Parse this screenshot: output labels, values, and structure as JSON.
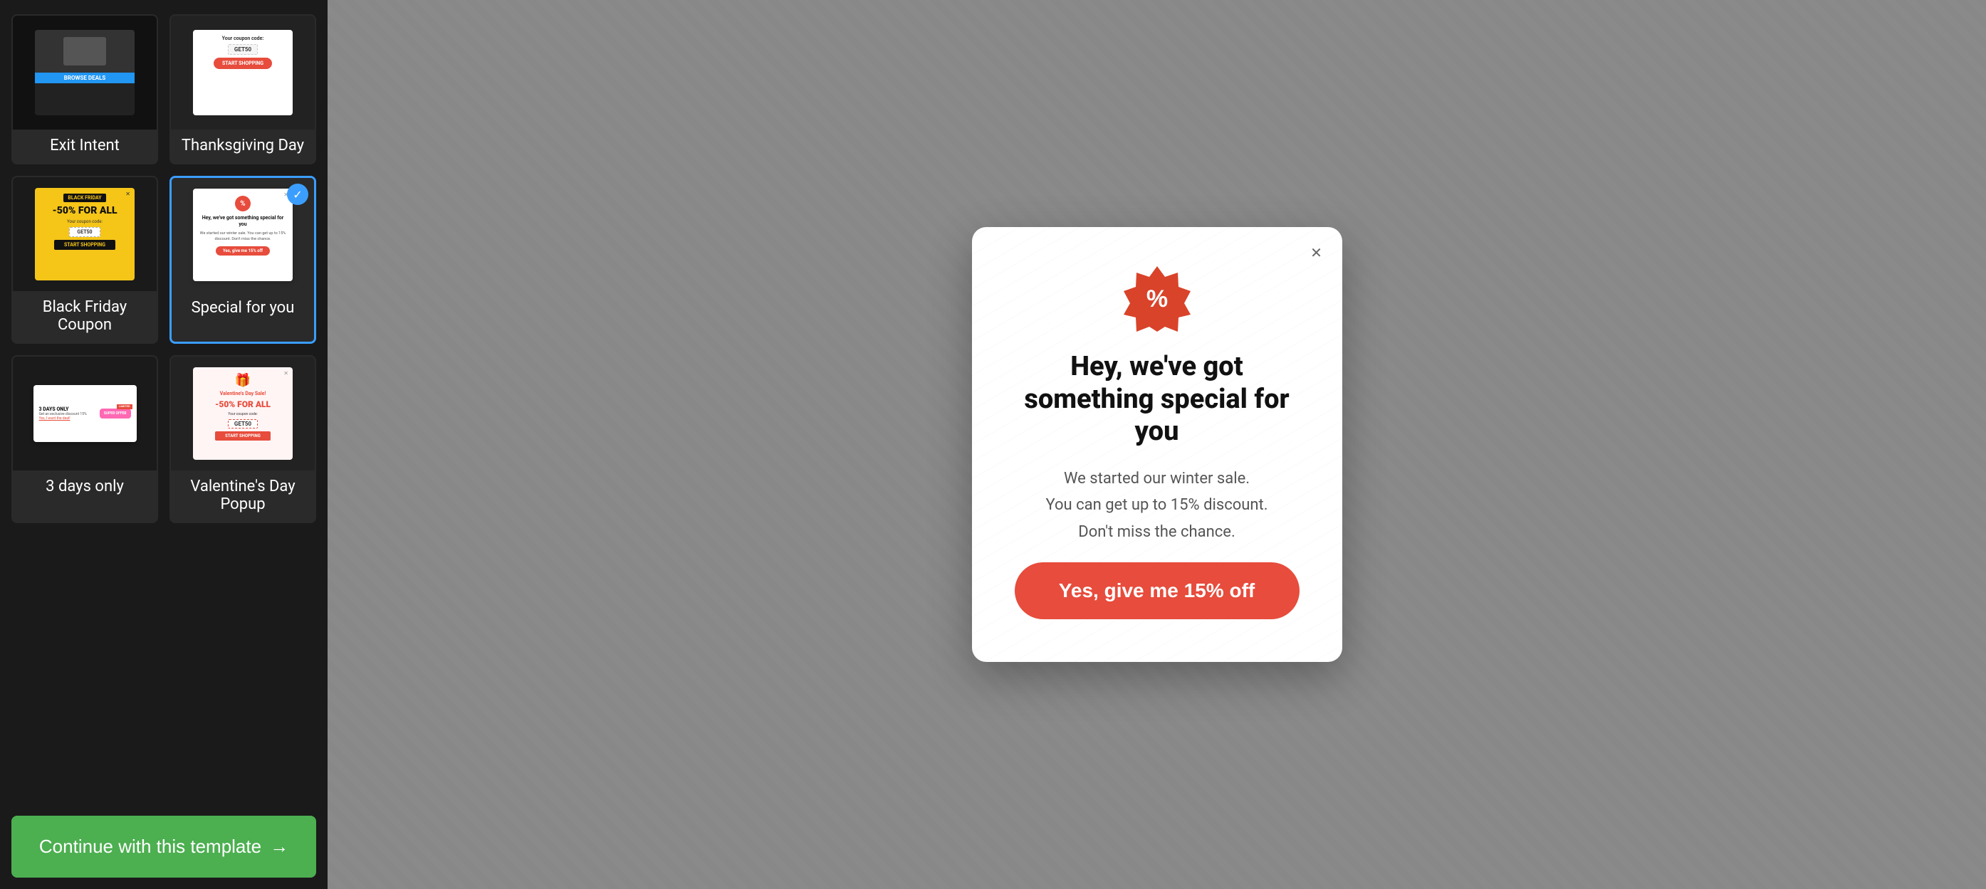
{
  "leftPanel": {
    "templates": [
      {
        "id": "exit-intent",
        "label": "Exit Intent",
        "selected": false
      },
      {
        "id": "thanksgiving-day",
        "label": "Thanksgiving Day",
        "selected": false
      },
      {
        "id": "black-friday-coupon",
        "label": "Black Friday Coupon",
        "selected": false
      },
      {
        "id": "special-for-you",
        "label": "Special for you",
        "selected": true
      },
      {
        "id": "3-days-only",
        "label": "3 days only",
        "selected": false
      },
      {
        "id": "valentines-day-popup",
        "label": "Valentine's Day Popup",
        "selected": false
      }
    ],
    "continueButton": {
      "label": "Continue with this template",
      "arrow": "→"
    }
  },
  "modal": {
    "title": "Hey, we've got something special for you",
    "body": "We started our winter sale.\nYou can get up to 15% discount.\nDon't miss the chance.",
    "ctaLabel": "Yes, give me 15% off",
    "closeIcon": "✕",
    "discountSymbol": "%"
  },
  "thumbnails": {
    "exitIntent": {
      "btnLabel": "BROWSE DEALS"
    },
    "thanksgiving": {
      "couponCode": "GET50",
      "btnLabel": "START SHOPPING"
    },
    "blackFriday": {
      "badge": "BLACK FRIDAY",
      "discount": "-50% FOR ALL",
      "couponLabel": "Your coupon code:",
      "couponCode": "GET50",
      "btnLabel": "START SHOPPING"
    },
    "specialForYou": {
      "title": "Hey, we've got something special for you",
      "body": "We started our winter sale. You can get up to 15% discount. Don't miss the chance.",
      "cta": "Yes, give me 15% off"
    },
    "threeDays": {
      "label": "3 DAYS ONLY",
      "sub": "Get an exclusive discount 15%",
      "link": "Yes, I want the deal!",
      "badge": "SUPER OFFER",
      "limited": "LIMITED"
    },
    "valentine": {
      "title": "Valentine's Day Sale!",
      "discount": "-50% FOR ALL",
      "couponLabel": "Your coupon code:",
      "couponCode": "GET50",
      "btnLabel": "START SHOPPING"
    }
  },
  "colors": {
    "accent": "#4CAF50",
    "selected": "#3b9eff",
    "cta": "#e74c3c",
    "bg": "#1a1a1a",
    "rightBg": "#888888"
  }
}
